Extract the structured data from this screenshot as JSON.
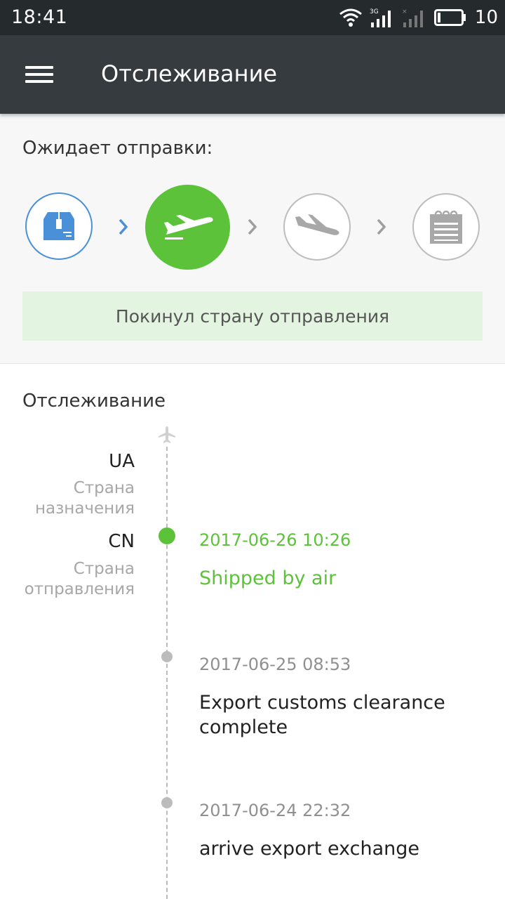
{
  "status_bar": {
    "time": "18:41",
    "network": "3G",
    "battery": "10"
  },
  "app_bar": {
    "title": "Отслеживание"
  },
  "summary": {
    "label": "Ожидает отправки:",
    "current_status": "Покинул страну отправления",
    "steps": [
      "package-icon",
      "plane-takeoff-icon",
      "plane-landing-icon",
      "notepad-icon"
    ],
    "active_color": "#5cc23a",
    "first_step_color": "#4a90d9"
  },
  "tracking": {
    "title": "Отслеживание",
    "destination": {
      "code": "UA",
      "label": "Страна назначения"
    },
    "origin": {
      "code": "CN",
      "label": "Страна отправления"
    },
    "events": [
      {
        "date": "2017-06-26 10:26",
        "text": "Shipped by air"
      },
      {
        "date": "2017-06-25 08:53",
        "text": "Export customs clearance complete"
      },
      {
        "date": "2017-06-24 22:32",
        "text": "arrive export exchange"
      }
    ]
  }
}
